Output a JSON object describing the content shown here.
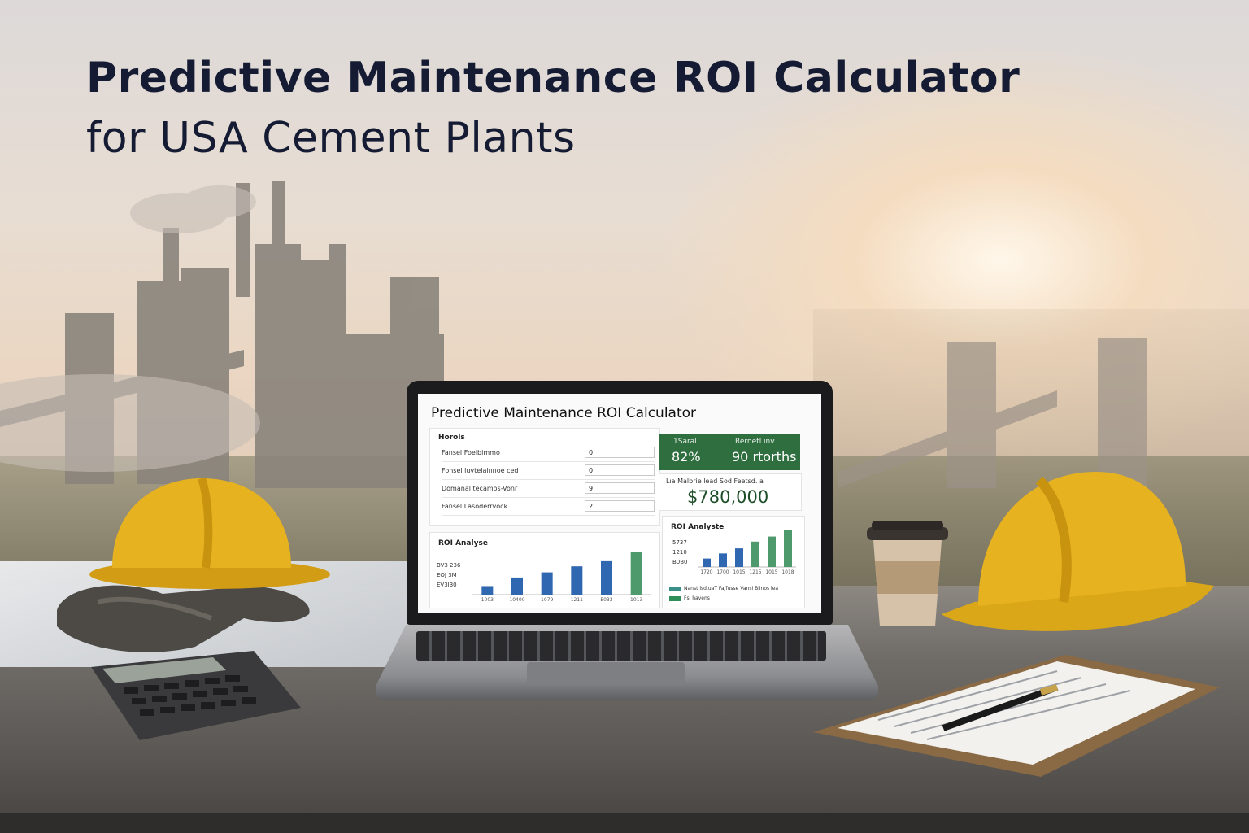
{
  "headline": {
    "line1": "Predictive Maintenance ROI Calculator",
    "line2": "for USA Cement Plants"
  },
  "screen": {
    "app_title": "Predictive Maintenance ROI Calculator",
    "inputs": {
      "heading": "Horols",
      "rows": [
        {
          "label": "Fansel Foeibimmo",
          "value": "0"
        },
        {
          "label": "Fonsel luvtelainnoe ced",
          "value": "0"
        },
        {
          "label": "Domanal tecamos-Vonr",
          "value": "9"
        },
        {
          "label": "Fansel Lasoderrvock",
          "value": "2"
        }
      ]
    },
    "kpi": {
      "left_label": "1Saral",
      "left_value": "82%",
      "right_label": "Rernetl ınv",
      "right_value": "90 rtorths"
    },
    "savings": {
      "label": "Lıa Malbrie lead Sod Feetsd. a",
      "value": "$780,000"
    },
    "roi_chart": {
      "title": "ROI Analyse",
      "y_labels": [
        "BV3 236",
        "EOJ 3M",
        "EV3I30"
      ],
      "x_labels": [
        "1003",
        "10400",
        "1079",
        "1211",
        "E033",
        "1013"
      ]
    },
    "roi_chart2": {
      "title": "ROI Analyste",
      "y_labels": [
        "5737",
        "1210",
        "B0B0"
      ],
      "x_labels": [
        "1720",
        "1700",
        "1015",
        "1215",
        "1015",
        "1018"
      ],
      "legend": [
        {
          "label": "Nanst lsd.uaT Fa/fusse Vansi Blinos lea",
          "color": "#3a8f8a"
        },
        {
          "label": "FsI havens",
          "color": "#2f8f5a"
        }
      ]
    }
  },
  "chart_data": [
    {
      "type": "bar",
      "title": "ROI Analyse",
      "categories": [
        "1003",
        "10400",
        "1079",
        "1211",
        "E033",
        "1013"
      ],
      "values": [
        1,
        2,
        2.6,
        3.3,
        3.9,
        5.0
      ],
      "colors": [
        "#2f67b1",
        "#2f67b1",
        "#2f67b1",
        "#2f67b1",
        "#2f67b1",
        "#4e9a6c"
      ],
      "ylim": [
        0,
        5.5
      ]
    },
    {
      "type": "bar",
      "title": "ROI Analyste",
      "categories": [
        "1720",
        "1700",
        "1015",
        "1215",
        "1015",
        "1018"
      ],
      "values": [
        1,
        1.6,
        2.2,
        3.0,
        3.6,
        4.4
      ],
      "colors": [
        "#2f67b1",
        "#2f67b1",
        "#2f67b1",
        "#4e9a6c",
        "#4e9a6c",
        "#4e9a6c"
      ],
      "ylim": [
        0,
        5
      ]
    }
  ],
  "colors": {
    "title_text": "#141b33",
    "kpi_green": "#2f6e3f",
    "bar_blue": "#2f67b1",
    "bar_green": "#4e9a6c",
    "helmet_yellow": "#e7b21f"
  }
}
